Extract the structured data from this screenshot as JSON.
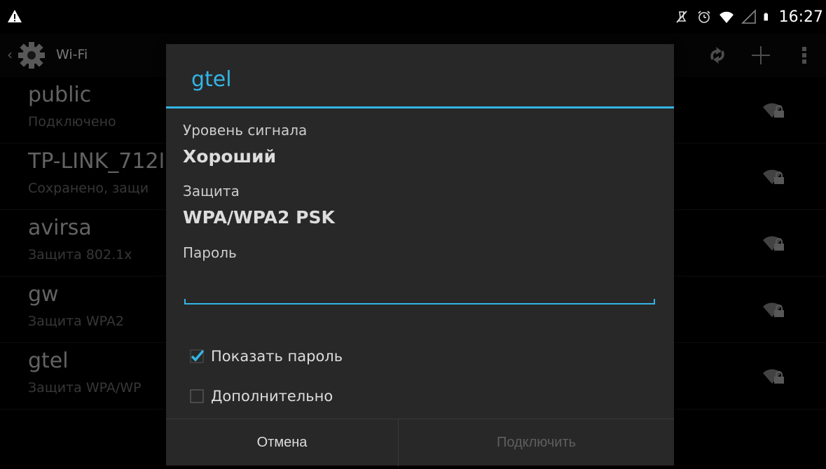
{
  "status_bar": {
    "time": "16:27",
    "icons": [
      "warning-icon",
      "mute-icon",
      "alarm-icon",
      "wifi-icon",
      "signal-icon",
      "battery-icon"
    ]
  },
  "action_bar": {
    "title": "Wi-Fi",
    "icons": [
      "back-chevron-icon",
      "settings-gear-icon",
      "wps-icon",
      "add-icon",
      "overflow-menu-icon"
    ]
  },
  "networks": [
    {
      "name": "public",
      "status": "Подключено"
    },
    {
      "name": "TP-LINK_712I",
      "status": "Сохранено, защи"
    },
    {
      "name": "avirsa",
      "status": "Защита 802.1x"
    },
    {
      "name": "gw",
      "status": "Защита WPA2"
    },
    {
      "name": "gtel",
      "status": "Защита WPA/WP"
    }
  ],
  "dialog": {
    "title": "gtel",
    "signal_label": "Уровень сигнала",
    "signal_value": "Хороший",
    "security_label": "Защита",
    "security_value": "WPA/WPA2 PSK",
    "password_label": "Пароль",
    "password_value": "",
    "show_password": {
      "label": "Показать пароль",
      "checked": true
    },
    "advanced": {
      "label": "Дополнительно",
      "checked": false
    },
    "cancel_label": "Отмена",
    "connect_label": "Подключить"
  },
  "colors": {
    "accent": "#33b5e5",
    "dialog_bg": "#282828",
    "disabled_text": "#5e5e5e"
  }
}
